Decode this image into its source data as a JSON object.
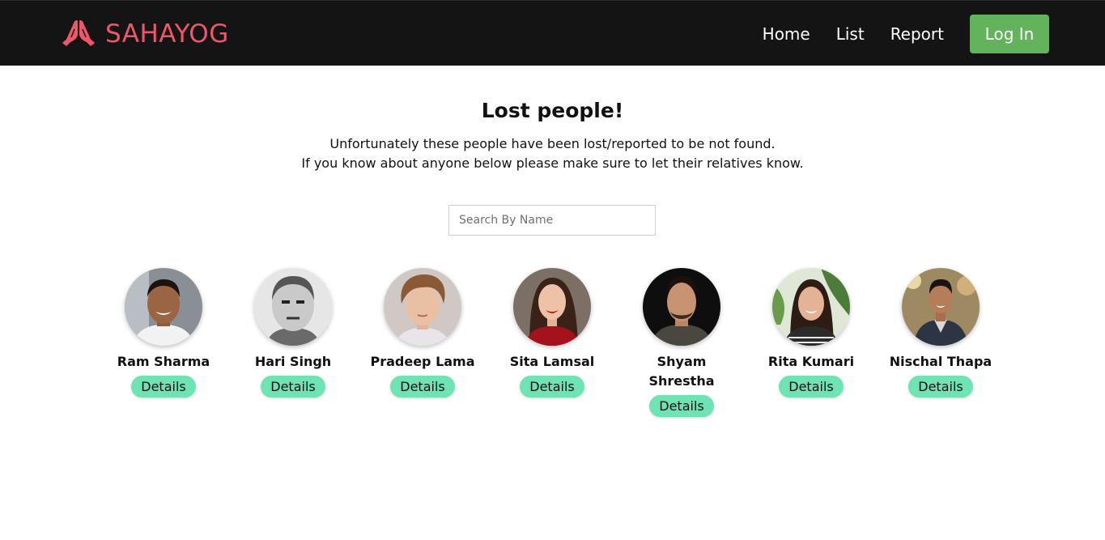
{
  "brand": {
    "name": "SAHAYOG",
    "color": "#f0566a",
    "logo_icon": "folded-hands-icon"
  },
  "nav": {
    "links": [
      "Home",
      "List",
      "Report"
    ],
    "login_label": "Log In"
  },
  "main": {
    "title": "Lost people!",
    "subtitle_line1": "Unfortunately these people have been lost/reported to be not found.",
    "subtitle_line2": "If you know about anyone below please make sure to let their relatives know.",
    "search_placeholder": "Search By Name"
  },
  "people": [
    {
      "name": "Ram Sharma",
      "details_label": "Details"
    },
    {
      "name": "Hari Singh",
      "details_label": "Details"
    },
    {
      "name": "Pradeep Lama",
      "details_label": "Details"
    },
    {
      "name": "Sita Lamsal",
      "details_label": "Details"
    },
    {
      "name": "Shyam Shrestha",
      "details_label": "Details"
    },
    {
      "name": "Rita Kumari",
      "details_label": "Details"
    },
    {
      "name": "Nischal Thapa",
      "details_label": "Details"
    }
  ],
  "colors": {
    "navbar": "#141414",
    "login_button": "#62b35b",
    "details_button": "#6ee3b4"
  }
}
